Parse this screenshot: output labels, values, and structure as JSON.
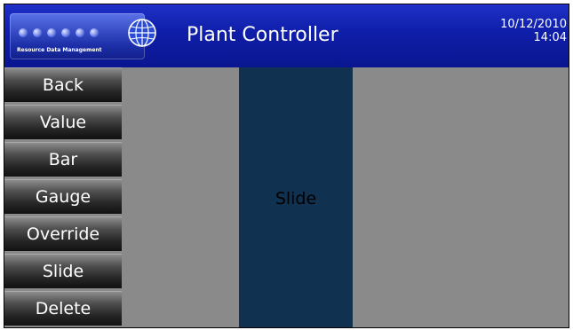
{
  "header": {
    "logo_text": "Resource Data Management",
    "title": "Plant Controller",
    "date": "10/12/2010",
    "time": "14:04"
  },
  "sidebar": {
    "items": [
      {
        "label": "Back"
      },
      {
        "label": "Value"
      },
      {
        "label": "Bar"
      },
      {
        "label": "Gauge"
      },
      {
        "label": "Override"
      },
      {
        "label": "Slide"
      },
      {
        "label": "Delete"
      }
    ]
  },
  "main": {
    "slide_label": "Slide"
  },
  "colors": {
    "header_blue": "#0f1ea8",
    "slide_panel": "#113150",
    "canvas_gray": "#8a8a8a",
    "button_dark": "#262626"
  }
}
